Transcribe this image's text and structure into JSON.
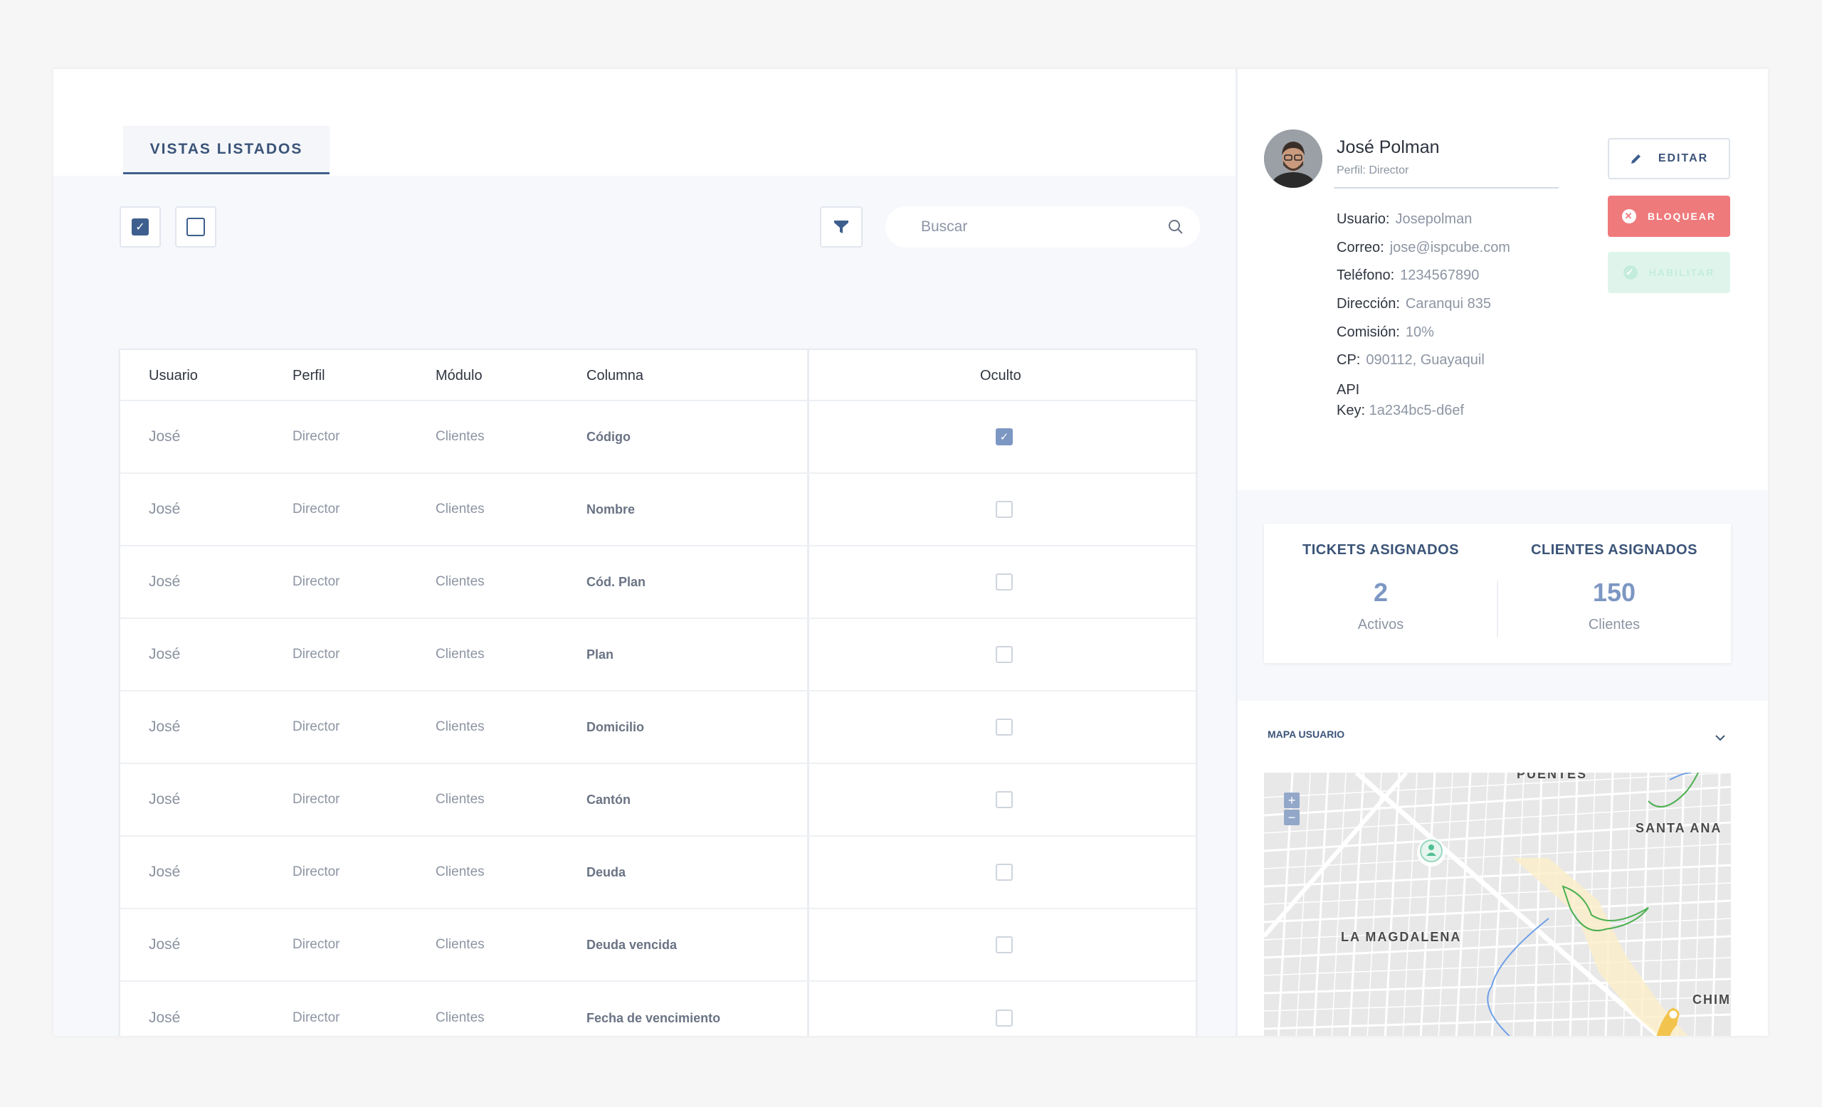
{
  "tab": {
    "label": "VISTAS LISTADOS"
  },
  "toolbar": {
    "search_placeholder": "Buscar"
  },
  "table": {
    "headers": [
      "Usuario",
      "Perfil",
      "Módulo",
      "Columna",
      "Oculto"
    ],
    "rows": [
      {
        "usuario": "José",
        "perfil": "Director",
        "modulo": "Clientes",
        "columna": "Código",
        "oculto": true
      },
      {
        "usuario": "José",
        "perfil": "Director",
        "modulo": "Clientes",
        "columna": "Nombre",
        "oculto": false
      },
      {
        "usuario": "José",
        "perfil": "Director",
        "modulo": "Clientes",
        "columna": "Cód. Plan",
        "oculto": false
      },
      {
        "usuario": "José",
        "perfil": "Director",
        "modulo": "Clientes",
        "columna": "Plan",
        "oculto": false
      },
      {
        "usuario": "José",
        "perfil": "Director",
        "modulo": "Clientes",
        "columna": "Domicilio",
        "oculto": false
      },
      {
        "usuario": "José",
        "perfil": "Director",
        "modulo": "Clientes",
        "columna": "Cantón",
        "oculto": false
      },
      {
        "usuario": "José",
        "perfil": "Director",
        "modulo": "Clientes",
        "columna": "Deuda",
        "oculto": false
      },
      {
        "usuario": "José",
        "perfil": "Director",
        "modulo": "Clientes",
        "columna": "Deuda vencida",
        "oculto": false
      },
      {
        "usuario": "José",
        "perfil": "Director",
        "modulo": "Clientes",
        "columna": "Fecha de vencimiento",
        "oculto": false
      }
    ]
  },
  "profile": {
    "name": "José Polman",
    "role": "Perfil: Director",
    "fields": [
      {
        "label": "Usuario:",
        "value": "Josepolman"
      },
      {
        "label": "Correo:",
        "value": "jose@ispcube.com"
      },
      {
        "label": "Teléfono:",
        "value": "1234567890"
      },
      {
        "label": "Dirección:",
        "value": "Caranqui 835"
      },
      {
        "label": "Comisión:",
        "value": "10%"
      },
      {
        "label": "CP:",
        "value": "090112, Guayaquil"
      }
    ],
    "api_label_1": "API",
    "api_label_2": "Key:",
    "api_value": "1a234bc5-d6ef"
  },
  "actions": {
    "edit": "EDITAR",
    "block": "BLOQUEAR",
    "enable": "HABILITAR"
  },
  "stats": {
    "tickets_title": "TICKETS ASIGNADOS",
    "tickets_value": "2",
    "tickets_sub": "Activos",
    "clients_title": "CLIENTES ASIGNADOS",
    "clients_value": "150",
    "clients_sub": "Clientes"
  },
  "map": {
    "title": "MAPA USUARIO",
    "zoom_in": "+",
    "zoom_out": "−",
    "labels": {
      "puentes": "PUENTES",
      "santa_ana": "SANTA ANA",
      "magdalena": "LA MAGDALENA",
      "chim": "CHIM"
    }
  },
  "colors": {
    "primary": "#3e5f8e",
    "danger": "#ef7a7c",
    "success_light": "#dff5ec",
    "accent": "#7d97c3"
  },
  "icons": {
    "filter": "filter-icon",
    "search": "search-icon",
    "edit": "pencil-icon",
    "block": "close-circle-icon",
    "enable": "check-circle-icon",
    "collapse": "chevron-down-icon"
  }
}
